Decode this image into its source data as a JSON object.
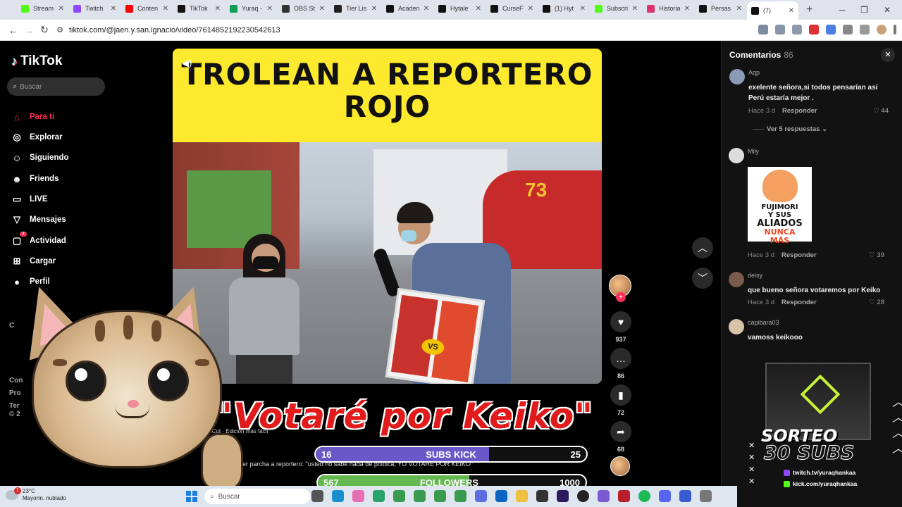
{
  "browser": {
    "tabs": [
      {
        "label": "Stream",
        "color": "#53fc18"
      },
      {
        "label": "Twitch",
        "color": "#9146ff"
      },
      {
        "label": "Conten",
        "color": "#ff0000"
      },
      {
        "label": "TikTok",
        "color": "#111111"
      },
      {
        "label": "Yuraq -",
        "color": "#0f9d58"
      },
      {
        "label": "OBS St",
        "color": "#333333"
      },
      {
        "label": "Tier Lis",
        "color": "#222222"
      },
      {
        "label": "Acaden",
        "color": "#111111"
      },
      {
        "label": "Hytale",
        "color": "#111111"
      },
      {
        "label": "CurseFo",
        "color": "#111111"
      },
      {
        "label": "(1) Hyt",
        "color": "#111111"
      },
      {
        "label": "Subscri",
        "color": "#53fc18"
      },
      {
        "label": "Historia",
        "color": "#e1306c"
      },
      {
        "label": "Persas",
        "color": "#111111"
      },
      {
        "label": "(7)",
        "color": "#111111"
      }
    ],
    "new_tab": "+",
    "window_controls": [
      "─",
      "❐",
      "✕"
    ],
    "url": "tiktok.com/@jaen.y.san.ignacio/video/7614852192230542613"
  },
  "tiktok": {
    "logo_text": "TikTok",
    "search_placeholder": "Buscar",
    "nav": [
      {
        "label": "Para ti",
        "icon": "home-icon",
        "glyph": "⌂"
      },
      {
        "label": "Explorar",
        "icon": "compass-icon",
        "glyph": "◎"
      },
      {
        "label": "Siguiendo",
        "icon": "following-icon",
        "glyph": "☺"
      },
      {
        "label": "Friends",
        "icon": "friends-icon",
        "glyph": "☻"
      },
      {
        "label": "LIVE",
        "icon": "live-icon",
        "glyph": "▭"
      },
      {
        "label": "Mensajes",
        "icon": "messages-icon",
        "glyph": "▽"
      },
      {
        "label": "Actividad",
        "icon": "activity-icon",
        "glyph": "▢"
      },
      {
        "label": "Cargar",
        "icon": "upload-icon",
        "glyph": "⊞"
      },
      {
        "label": "Perfil",
        "icon": "profile-icon",
        "glyph": "●"
      }
    ],
    "activity_badge": "7",
    "side_partial": [
      "C",
      "Con",
      "Pro",
      "Ter",
      "© 2"
    ]
  },
  "video": {
    "banner_line1": "TROLEAN A REPORTERO",
    "banner_line2": "ROJO",
    "building_number": "73",
    "caption": "\"Votaré por Keiko\"",
    "capcut_text": "CapCut · Edición más fácil",
    "description": "er parcha a reportero: \"usted no sabe nada de política, YO VOTARÉ POR KEIKO\"",
    "poster_vs": "VS",
    "actions": {
      "likes": "937",
      "comments": "86",
      "saves": "72",
      "shares": "68"
    }
  },
  "comments": {
    "title": "Comentarios",
    "count": "86",
    "items": [
      {
        "user": "Aqp",
        "text": "exelente señora,si todos pensarían así Perú estaría mejor .",
        "time": "Hace 3 d",
        "reply": "Responder",
        "likes": "44"
      },
      {
        "user": "Mily",
        "text": "",
        "time": "Hace 3 d",
        "reply": "Responder",
        "likes": "39"
      },
      {
        "user": "deisy",
        "text": "que bueno señora votaremos por Keiko",
        "time": "Hace 3 d",
        "reply": "Responder",
        "likes": "28"
      },
      {
        "user": "capibara03",
        "text": "vamoss keikooo",
        "time": "",
        "reply": "",
        "likes": ""
      }
    ],
    "view_replies": "Ver 5 respuestas",
    "sticker": {
      "l1": "FUJIMORI",
      "l2": "Y SUS",
      "l3": "ALIADOS",
      "l4": "NUNCA",
      "l5": "MÁS"
    }
  },
  "overlay": {
    "subs_bar": {
      "current": "16",
      "label": "SUBS KICK",
      "goal": "25",
      "progress": 0.64
    },
    "followers_bar": {
      "current": "567",
      "label": "FOLLOWERS",
      "goal": "1000",
      "progress": 0.567
    },
    "promo": {
      "title1": "SORTEO",
      "title2": "30 SUBS",
      "link1": "twitch.tv/yuraqhankaa",
      "link2": "kick.com/yuraqhankaa"
    }
  },
  "taskbar": {
    "weather_temp": "23°C",
    "weather_desc": "Mayorm. nublado",
    "weather_badge": "1",
    "search_placeholder": "Buscar"
  }
}
